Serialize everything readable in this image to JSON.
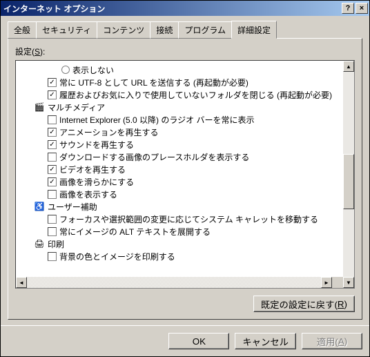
{
  "title": "インターネット オプション",
  "titlebar": {
    "help": "?",
    "close": "×"
  },
  "tabs": [
    "全般",
    "セキュリティ",
    "コンテンツ",
    "接続",
    "プログラム",
    "詳細設定"
  ],
  "active_tab": 5,
  "settings_label_pre": "設定(",
  "settings_label_key": "S",
  "settings_label_post": "):",
  "tree": [
    {
      "type": "radio",
      "checked": false,
      "indent": 3,
      "label": "表示しない"
    },
    {
      "type": "check",
      "checked": true,
      "indent": 2,
      "label": "常に UTF-8 として URL を送信する (再起動が必要)"
    },
    {
      "type": "check",
      "checked": true,
      "indent": 2,
      "label": "履歴およびお気に入りで使用していないフォルダを閉じる (再起動が必要)"
    },
    {
      "type": "category",
      "icon": "multimedia-icon",
      "indent": 1,
      "label": "マルチメディア"
    },
    {
      "type": "check",
      "checked": false,
      "indent": 2,
      "label": "Internet Explorer (5.0 以降) のラジオ バーを常に表示"
    },
    {
      "type": "check",
      "checked": true,
      "indent": 2,
      "label": "アニメーションを再生する"
    },
    {
      "type": "check",
      "checked": true,
      "indent": 2,
      "label": "サウンドを再生する"
    },
    {
      "type": "check",
      "checked": false,
      "indent": 2,
      "label": "ダウンロードする画像のプレースホルダを表示する"
    },
    {
      "type": "check",
      "checked": true,
      "indent": 2,
      "label": "ビデオを再生する"
    },
    {
      "type": "check",
      "checked": true,
      "indent": 2,
      "label": "画像を滑らかにする"
    },
    {
      "type": "check",
      "checked": false,
      "indent": 2,
      "label": "画像を表示する"
    },
    {
      "type": "category",
      "icon": "accessibility-icon",
      "indent": 1,
      "label": "ユーザー補助"
    },
    {
      "type": "check",
      "checked": false,
      "indent": 2,
      "label": "フォーカスや選択範囲の変更に応じてシステム キャレットを移動する"
    },
    {
      "type": "check",
      "checked": false,
      "indent": 2,
      "label": "常にイメージの ALT テキストを展開する"
    },
    {
      "type": "category",
      "icon": "printer-icon",
      "indent": 1,
      "label": "印刷"
    },
    {
      "type": "check",
      "checked": false,
      "indent": 2,
      "label": "背景の色とイメージを印刷する"
    }
  ],
  "restore_label": "既定の設定に戻す(",
  "restore_key": "R",
  "restore_post": ")",
  "buttons": {
    "ok": "OK",
    "cancel": "キャンセル",
    "apply": "適用(",
    "apply_key": "A",
    "apply_post": ")"
  },
  "icons": {
    "multimedia-icon": "🎬",
    "accessibility-icon": "♿",
    "printer-icon": "🖨"
  }
}
